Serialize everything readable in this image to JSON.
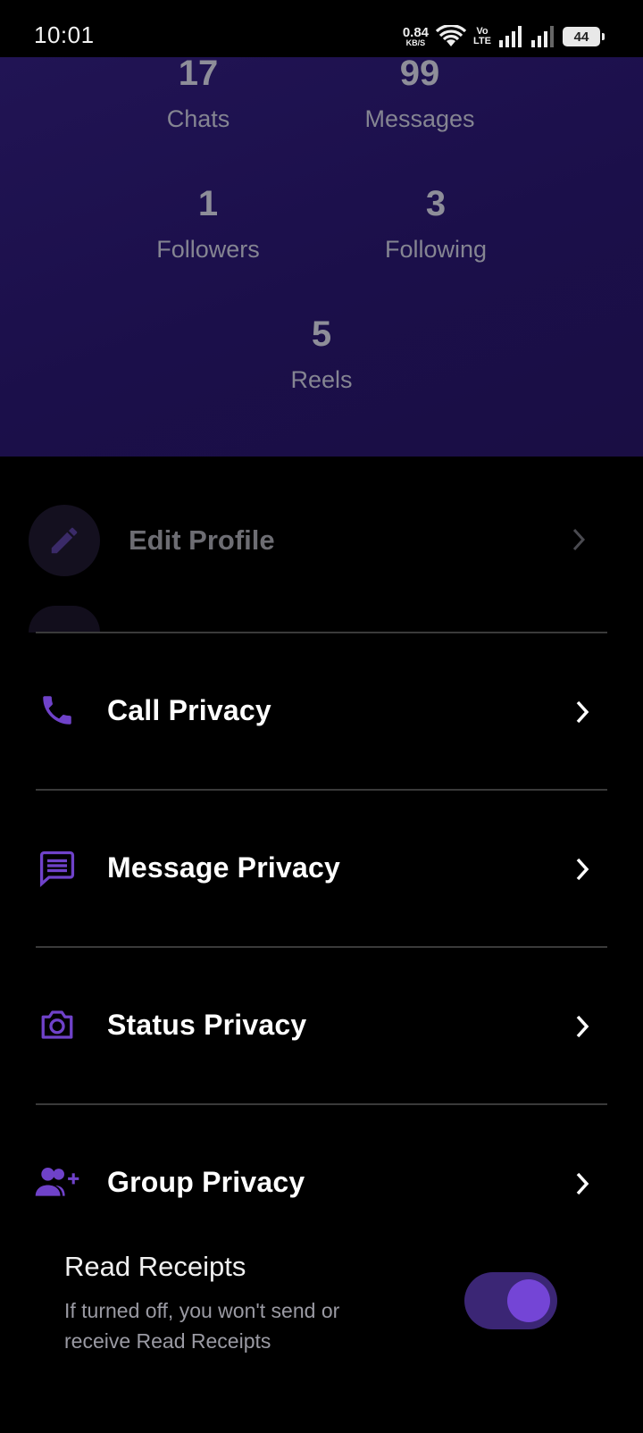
{
  "status_bar": {
    "time": "10:01",
    "net_speed_value": "0.84",
    "net_speed_unit": "KB/S",
    "volte_top": "Vo",
    "volte_bottom": "LTE",
    "battery": "44"
  },
  "stats": {
    "chats": {
      "value": "17",
      "label": "Chats"
    },
    "messages": {
      "value": "99",
      "label": "Messages"
    },
    "followers": {
      "value": "1",
      "label": "Followers"
    },
    "following": {
      "value": "3",
      "label": "Following"
    },
    "reels": {
      "value": "5",
      "label": "Reels"
    }
  },
  "edit_profile": {
    "label": "Edit Profile",
    "icon": "pencil-icon"
  },
  "menu": [
    {
      "label": "Call Privacy",
      "icon": "phone-icon"
    },
    {
      "label": "Message Privacy",
      "icon": "message-icon"
    },
    {
      "label": "Status Privacy",
      "icon": "camera-icon"
    },
    {
      "label": "Group Privacy",
      "icon": "group-add-icon"
    }
  ],
  "read_receipts": {
    "title": "Read Receipts",
    "description": "If turned off, you won't send or receive Read Receipts",
    "enabled": true
  },
  "colors": {
    "accent": "#6f42c9",
    "stats_bg": "#1c1049",
    "toggle_track": "#3b2675",
    "toggle_knob": "#7445d6"
  }
}
